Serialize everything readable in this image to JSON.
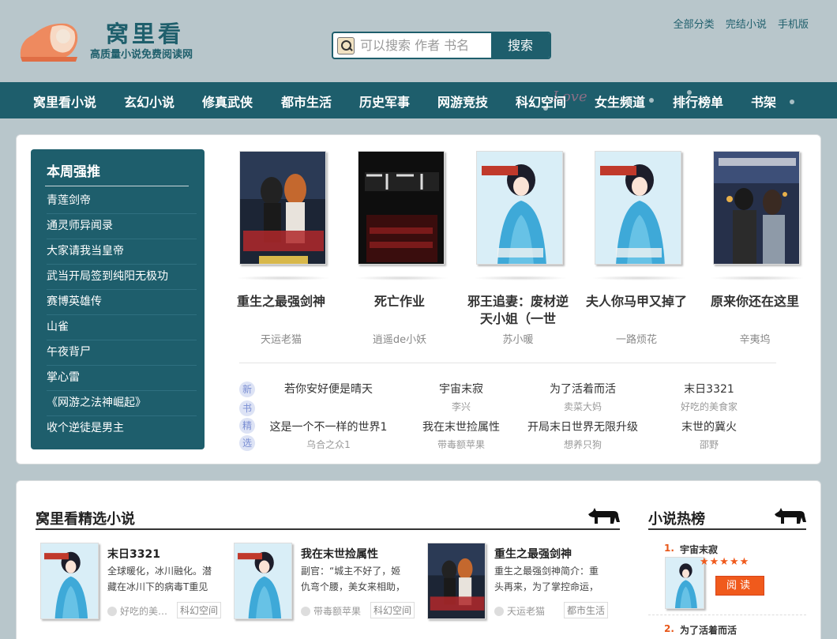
{
  "header": {
    "logo_title": "窝里看",
    "logo_subtitle": "高质量小说免费阅读网",
    "search_placeholder": "可以搜索 作者 书名",
    "search_button": "搜索",
    "links": [
      "全部分类",
      "完结小说",
      "手机版"
    ]
  },
  "nav": {
    "items": [
      "窝里看小说",
      "玄幻小说",
      "修真武侠",
      "都市生活",
      "历史军事",
      "网游竞技",
      "科幻空间",
      "女生频道",
      "排行榜单",
      "书架"
    ],
    "decoration": "Love"
  },
  "weekly": {
    "title": "本周强推",
    "items": [
      "青莲剑帝",
      "通灵师异闻录",
      "大家请我当皇帝",
      "武当开局签到纯阳无极功",
      "赛博英雄传",
      "山雀",
      "午夜背尸",
      "掌心雷",
      "《网游之法神崛起》",
      "收个逆徒是男主"
    ]
  },
  "recommend": [
    {
      "title": "重生之最强剑神",
      "author": "天运老猫",
      "cover": "sword"
    },
    {
      "title": "死亡作业",
      "author": "逍遥de小妖",
      "cover": "dark"
    },
    {
      "title": "邪王追妻：废材逆天小姐（一世",
      "author": "苏小暖",
      "cover": "blue"
    },
    {
      "title": "夫人你马甲又掉了",
      "author": "一路烦花",
      "cover": "blue"
    },
    {
      "title": "原来你还在这里",
      "author": "辛夷坞",
      "cover": "city"
    }
  ],
  "new_books": {
    "tag": [
      "新",
      "书",
      "精",
      "选"
    ],
    "rows": [
      [
        {
          "title": "若你安好便是晴天",
          "author": ""
        },
        {
          "title": "宇宙末寂",
          "author": "李兴"
        },
        {
          "title": "为了活着而活",
          "author": "卖菜大妈"
        },
        {
          "title": "末日3321",
          "author": "好吃的美食家"
        }
      ],
      [
        {
          "title": "这是一个不一样的世界1",
          "author": "乌合之众1"
        },
        {
          "title": "我在末世捡属性",
          "author": "带毒额苹果"
        },
        {
          "title": "开局末日世界无限升级",
          "author": "想养只狗"
        },
        {
          "title": "末世的冀火",
          "author": "邵野"
        }
      ]
    ]
  },
  "picks": {
    "title": "窝里看精选小说",
    "items": [
      {
        "title": "末日3321",
        "desc": "全球暖化，冰川融化。潜藏在冰川下的病毒T重见天日",
        "author": "好吃的美…",
        "tag": "科幻空间",
        "cover": "blue"
      },
      {
        "title": "我在末世捡属性",
        "desc": "副官：“城主不好了，姬仇弯个腰，美女来相助，杀我",
        "author": "带毒额苹果",
        "tag": "科幻空间",
        "cover": "blue"
      },
      {
        "title": "重生之最强剑神",
        "desc": "重生之最强剑神简介：重头再来，为了掌控命运，再次",
        "author": "天运老猫",
        "tag": "都市生活",
        "cover": "sword"
      }
    ]
  },
  "hot": {
    "title": "小说热榜",
    "items": [
      {
        "num": "1.",
        "name": "宇宙末寂"
      },
      {
        "num": "2.",
        "name": "为了活着而活"
      }
    ],
    "stars": "★★★★★",
    "rating": 5,
    "read_button": "阅读"
  },
  "colors": {
    "primary": "#1e5e6c",
    "accent": "#f05a1c",
    "background": "#b8c6cb"
  }
}
